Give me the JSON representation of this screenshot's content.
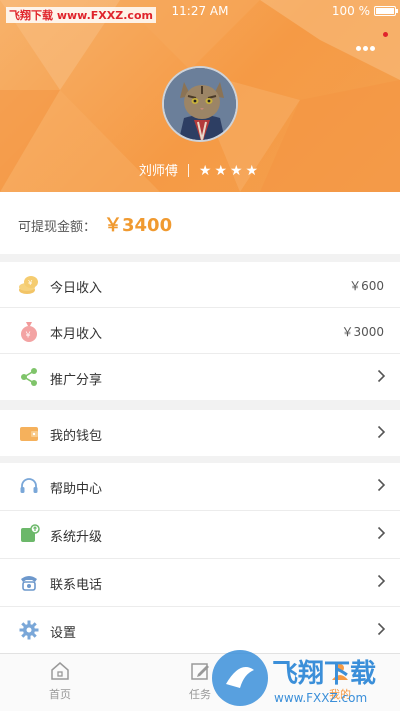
{
  "status_bar": {
    "brand": "飞翔下载 www.FXXZ.com",
    "time": "11:27 AM",
    "battery": "100 %"
  },
  "profile": {
    "name": "刘师傅",
    "stars": "★★★★",
    "rating": 4
  },
  "balance": {
    "label": "可提现金额：",
    "amount": "￥3400"
  },
  "menu_group1": [
    {
      "label": "今日收入",
      "value": "￥600",
      "icon": "coins-icon"
    },
    {
      "label": "本月收入",
      "value": "￥3000",
      "icon": "money-bag-icon"
    },
    {
      "label": "推广分享",
      "value": "",
      "icon": "share-icon"
    }
  ],
  "menu_group2": [
    {
      "label": "我的钱包",
      "value": "",
      "icon": "wallet-icon"
    }
  ],
  "menu_group3": [
    {
      "label": "帮助中心",
      "icon": "headset-icon"
    },
    {
      "label": "系统升级",
      "icon": "upgrade-icon"
    },
    {
      "label": "联系电话",
      "icon": "phone-icon"
    },
    {
      "label": "设置",
      "icon": "gear-icon"
    }
  ],
  "tabbar": {
    "home": "首页",
    "tasks": "任务",
    "mine": "我的"
  },
  "watermark": {
    "text_cn": "飞翔下载",
    "text_url": "www.FXXZ.com"
  },
  "colors": {
    "accent": "#f59a45",
    "amount": "#f09a30"
  }
}
